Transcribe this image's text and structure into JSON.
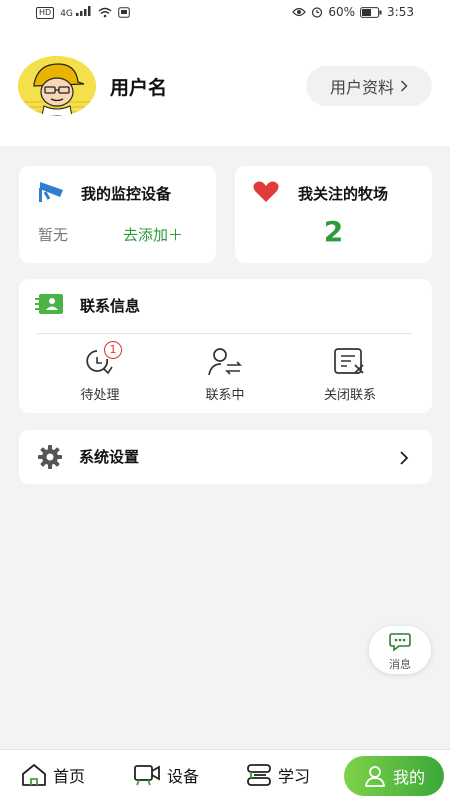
{
  "status_bar": {
    "network": "HD",
    "signal": "4G",
    "battery": "60%",
    "time": "3:53"
  },
  "header": {
    "username": "用户名",
    "profile_button": "用户资料"
  },
  "monitor": {
    "title": "我的监控设备",
    "none": "暂无",
    "add": "去添加＋"
  },
  "farm": {
    "title": "我关注的牧场",
    "count": "2"
  },
  "contact": {
    "title": "联系信息",
    "items": [
      {
        "label": "待处理",
        "badge": "1"
      },
      {
        "label": "联系中"
      },
      {
        "label": "关闭联系"
      }
    ]
  },
  "settings": {
    "title": "系统设置"
  },
  "message_button": {
    "label": "消息"
  },
  "tabbar": {
    "items": [
      {
        "label": "首页"
      },
      {
        "label": "设备"
      },
      {
        "label": "学习"
      },
      {
        "label": "我的"
      }
    ]
  },
  "colors": {
    "accent": "#2e9b3a",
    "badge": "#d33333",
    "heart": "#e03a3a"
  }
}
